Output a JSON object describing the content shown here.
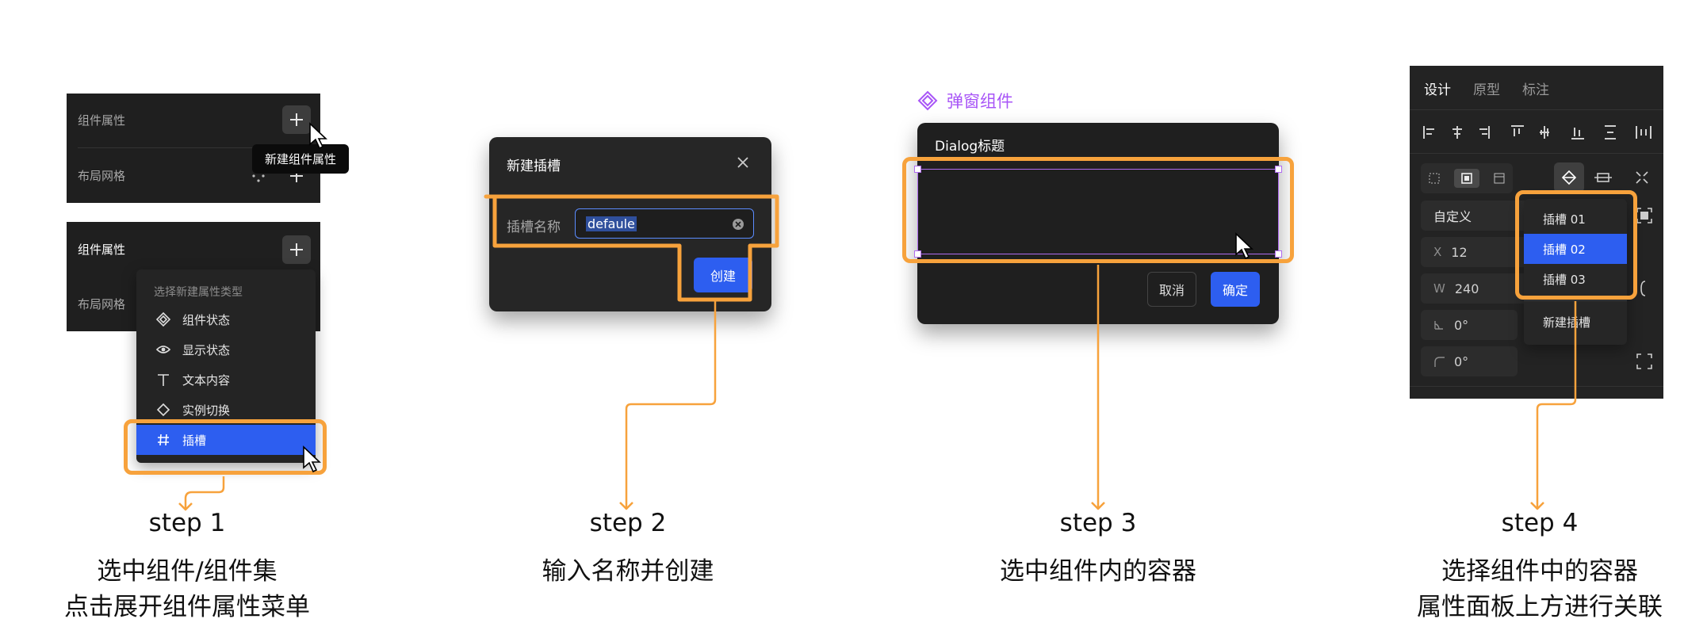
{
  "step1": {
    "top": {
      "title": "组件属性",
      "row2": "布局网格",
      "tooltip": "新建组件属性"
    },
    "bottom": {
      "title": "组件属性",
      "row2": "布局网格"
    },
    "menu": {
      "header": "选择新建属性类型",
      "items": [
        {
          "label": "组件状态",
          "icon": "diamond-outline-icon"
        },
        {
          "label": "显示状态",
          "icon": "eye-icon"
        },
        {
          "label": "文本内容",
          "icon": "text-t-icon"
        },
        {
          "label": "实例切换",
          "icon": "diamond-icon"
        },
        {
          "label": "插槽",
          "icon": "hash-icon"
        }
      ]
    },
    "step_label": "step 1",
    "caption": [
      "选中组件/组件集",
      "点击展开组件属性菜单"
    ]
  },
  "step2": {
    "dialog_title": "新建插槽",
    "field_label": "插槽名称",
    "field_value": "defaule",
    "create_label": "创建",
    "step_label": "step 2",
    "caption": [
      "输入名称并创建"
    ]
  },
  "step3": {
    "component_name": "弹窗组件",
    "dialog_title": "Dialog标题",
    "cancel_label": "取消",
    "confirm_label": "确定",
    "step_label": "step 3",
    "caption": [
      "选中组件内的容器"
    ]
  },
  "step4": {
    "tabs": [
      "设计",
      "原型",
      "标注"
    ],
    "mode": "自定义",
    "x_key": "X",
    "x_value": "12",
    "w_key": "W",
    "w_value": "240",
    "rotation": "0°",
    "radius": "0°",
    "dropdown": [
      "插槽 01",
      "插槽 02",
      "插槽 03"
    ],
    "selected_slot": "插槽 02",
    "new_slot": "新建插槽",
    "step_label": "step 4",
    "caption": [
      "选择组件中的容器",
      "属性面板上方进行关联"
    ]
  },
  "colors": {
    "accent_orange": "#f7a23c",
    "primary_blue": "#2d5ef0",
    "purple": "#a855f7",
    "dark_panel": "#1f1f1f"
  }
}
